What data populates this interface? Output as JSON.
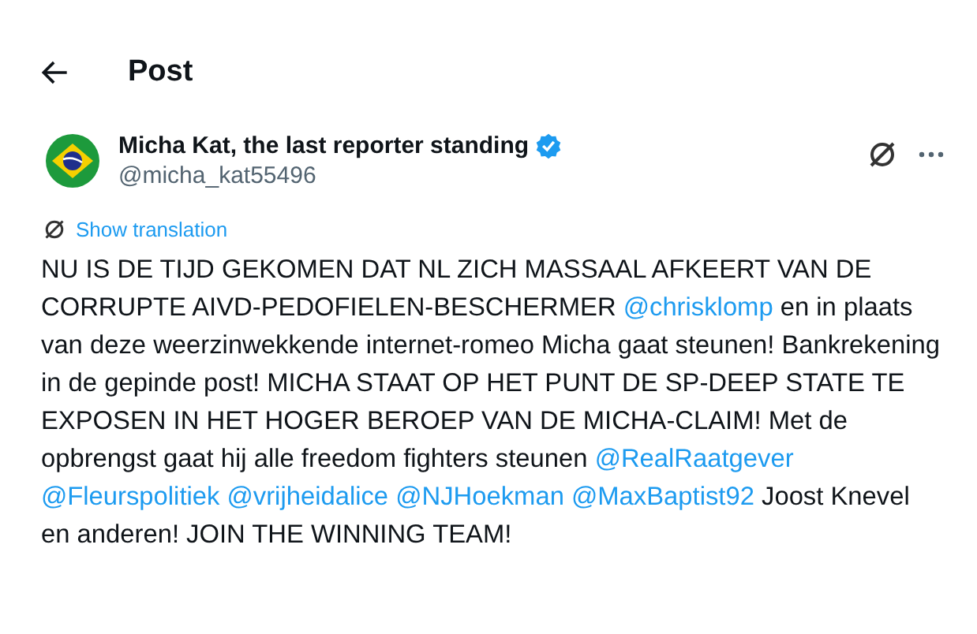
{
  "header": {
    "title": "Post"
  },
  "post": {
    "author": {
      "name": "Micha Kat, the last reporter standing",
      "verified": true,
      "handle": "@micha_kat55496"
    },
    "translate_link": "Show translation",
    "body": [
      {
        "kind": "text",
        "text": "NU IS DE TIJD GEKOMEN DAT NL ZICH MASSAAL AFKEERT VAN DE CORRUPTE AIVD-PEDOFIELEN-BESCHERMER "
      },
      {
        "kind": "mention",
        "text": "@chrisklomp"
      },
      {
        "kind": "text",
        "text": " en in plaats van deze weerzinwekkende internet-romeo Micha gaat steunen! Bankrekening in de gepinde post! MICHA STAAT OP HET PUNT DE SP-DEEP STATE TE EXPOSEN IN HET HOGER BEROEP VAN DE MICHA-CLAIM! Met de opbrengst gaat hij alle freedom fighters steunen "
      },
      {
        "kind": "mentions",
        "items": [
          "@RealRaatgever",
          "@Fleurspolitiek",
          "@vrijheidalice",
          "@NJHoekman",
          "@MaxBaptist92"
        ]
      },
      {
        "kind": "text",
        "text": " Joost Knevel en anderen! JOIN THE WINNING TEAM!"
      }
    ]
  }
}
